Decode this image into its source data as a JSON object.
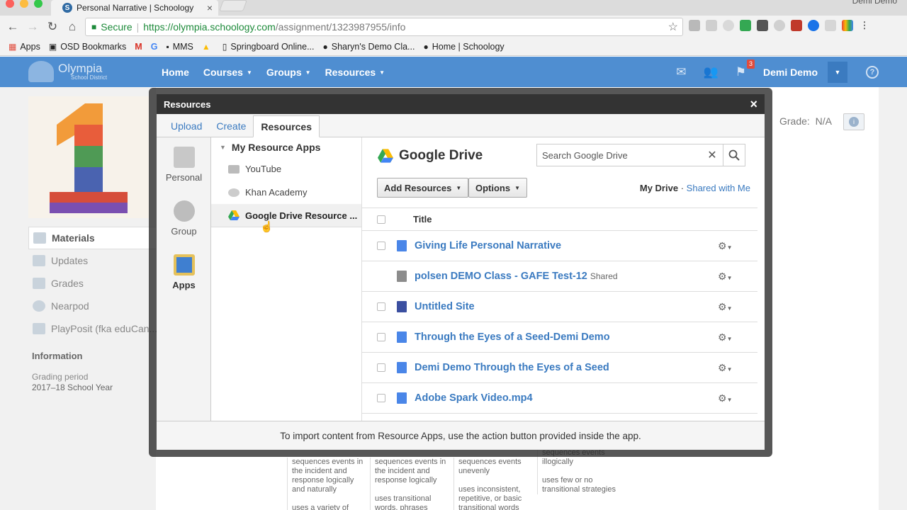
{
  "browser": {
    "tab_title": "Personal Narrative | Schoology",
    "tab_close": "×",
    "tab_favicon": "S",
    "profile_name": "Demi Demo",
    "url_secure": "Secure",
    "url_host": "https://olympia.schoology.com",
    "url_path": "/assignment/1323987955/info",
    "bookmarks": [
      "Apps",
      "OSD Bookmarks",
      "M",
      "G",
      "MMS",
      "",
      "Springboard Online...",
      "Sharyn's Demo Cla...",
      "Home | Schoology"
    ]
  },
  "schoology": {
    "logo_name": "Olympia",
    "logo_sub": "School District",
    "nav": [
      "Home",
      "Courses",
      "Groups",
      "Resources"
    ],
    "notification_count": "3",
    "user_name": "Demi Demo",
    "help": "?"
  },
  "page": {
    "left_nav": [
      "Materials",
      "Updates",
      "Grades",
      "Nearpod",
      "PlayPosit (fka eduCan..."
    ],
    "info_heading": "Information",
    "grading_period_label": "Grading period",
    "grading_period_value": "2017–18 School Year",
    "grade_label": "Grade:",
    "grade_value": "N/A",
    "rubric_cols": [
      "sequences events in the incident and response logically and naturally\n\nuses a variety of",
      "sequences events in the incident and response logically\n\nuses transitional words, phrases",
      "sequences events unevenly\n\nuses inconsistent, repetitive, or basic transitional words",
      "sequences events illogically\n\nuses few or no transitional strategies"
    ]
  },
  "modal": {
    "title": "Resources",
    "close": "×",
    "tabs": [
      "Upload",
      "Create",
      "Resources"
    ],
    "side": [
      "Personal",
      "Group",
      "Apps"
    ],
    "apps_heading": "My Resource Apps",
    "apps": [
      "YouTube",
      "Khan Academy",
      "Google Drive Resource ..."
    ],
    "drive_title": "Google Drive",
    "search_placeholder": "Search Google Drive",
    "search_clear": "✕",
    "add_resources": "Add Resources",
    "options": "Options",
    "my_drive": "My Drive",
    "dot": "·",
    "shared_with_me": "Shared with Me",
    "col_title": "Title",
    "files": [
      {
        "name": "Giving Life Personal Narrative",
        "tag": ""
      },
      {
        "name": "polsen DEMO Class - GAFE Test-12",
        "tag": "Shared"
      },
      {
        "name": "Untitled Site",
        "tag": ""
      },
      {
        "name": "Through the Eyes of a Seed-Demi Demo",
        "tag": ""
      },
      {
        "name": "Demi Demo Through the Eyes of a Seed",
        "tag": ""
      },
      {
        "name": "Adobe Spark Video.mp4",
        "tag": ""
      }
    ],
    "footer": "To import content from Resource Apps, use the action button provided inside the app."
  },
  "colors": {
    "header_blue": "#4f8ed1",
    "link_blue": "#3a7ac0",
    "modal_title_bg": "#333333"
  }
}
